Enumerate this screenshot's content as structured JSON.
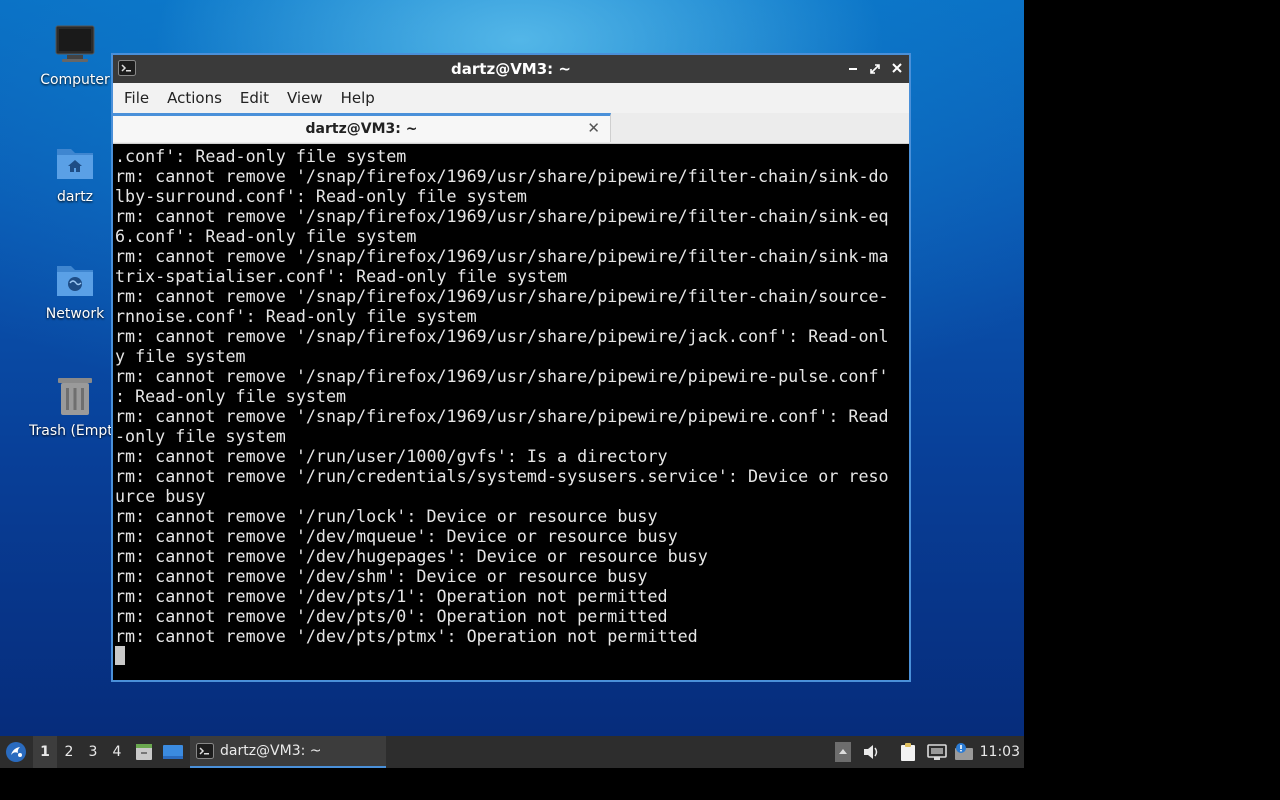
{
  "desktop": {
    "icons": [
      {
        "label": "Computer",
        "icon": "computer-icon"
      },
      {
        "label": "dartz",
        "icon": "home-folder-icon"
      },
      {
        "label": "Network",
        "icon": "network-folder-icon"
      },
      {
        "label": "Trash (Empty)",
        "icon": "trash-icon"
      }
    ]
  },
  "window": {
    "title": "dartz@VM3: ~",
    "menu": [
      "File",
      "Actions",
      "Edit",
      "View",
      "Help"
    ],
    "tab_title": "dartz@VM3: ~",
    "terminal_lines": [
      ".conf': Read-only file system",
      "rm: cannot remove '/snap/firefox/1969/usr/share/pipewire/filter-chain/sink-do",
      "lby-surround.conf': Read-only file system",
      "rm: cannot remove '/snap/firefox/1969/usr/share/pipewire/filter-chain/sink-eq",
      "6.conf': Read-only file system",
      "rm: cannot remove '/snap/firefox/1969/usr/share/pipewire/filter-chain/sink-ma",
      "trix-spatialiser.conf': Read-only file system",
      "rm: cannot remove '/snap/firefox/1969/usr/share/pipewire/filter-chain/source-",
      "rnnoise.conf': Read-only file system",
      "rm: cannot remove '/snap/firefox/1969/usr/share/pipewire/jack.conf': Read-onl",
      "y file system",
      "rm: cannot remove '/snap/firefox/1969/usr/share/pipewire/pipewire-pulse.conf'",
      ": Read-only file system",
      "rm: cannot remove '/snap/firefox/1969/usr/share/pipewire/pipewire.conf': Read",
      "-only file system",
      "rm: cannot remove '/run/user/1000/gvfs': Is a directory",
      "rm: cannot remove '/run/credentials/systemd-sysusers.service': Device or reso",
      "urce busy",
      "rm: cannot remove '/run/lock': Device or resource busy",
      "rm: cannot remove '/dev/mqueue': Device or resource busy",
      "rm: cannot remove '/dev/hugepages': Device or resource busy",
      "rm: cannot remove '/dev/shm': Device or resource busy",
      "rm: cannot remove '/dev/pts/1': Operation not permitted",
      "rm: cannot remove '/dev/pts/0': Operation not permitted",
      "rm: cannot remove '/dev/pts/ptmx': Operation not permitted"
    ]
  },
  "panel": {
    "workspaces": [
      "1",
      "2",
      "3",
      "4"
    ],
    "active_workspace": "1",
    "task_label": "dartz@VM3: ~",
    "clock": "11:03"
  },
  "colors": {
    "accent": "#4a90d9",
    "panel": "#2d2d2d",
    "titlebar": "#3a3a3a"
  }
}
